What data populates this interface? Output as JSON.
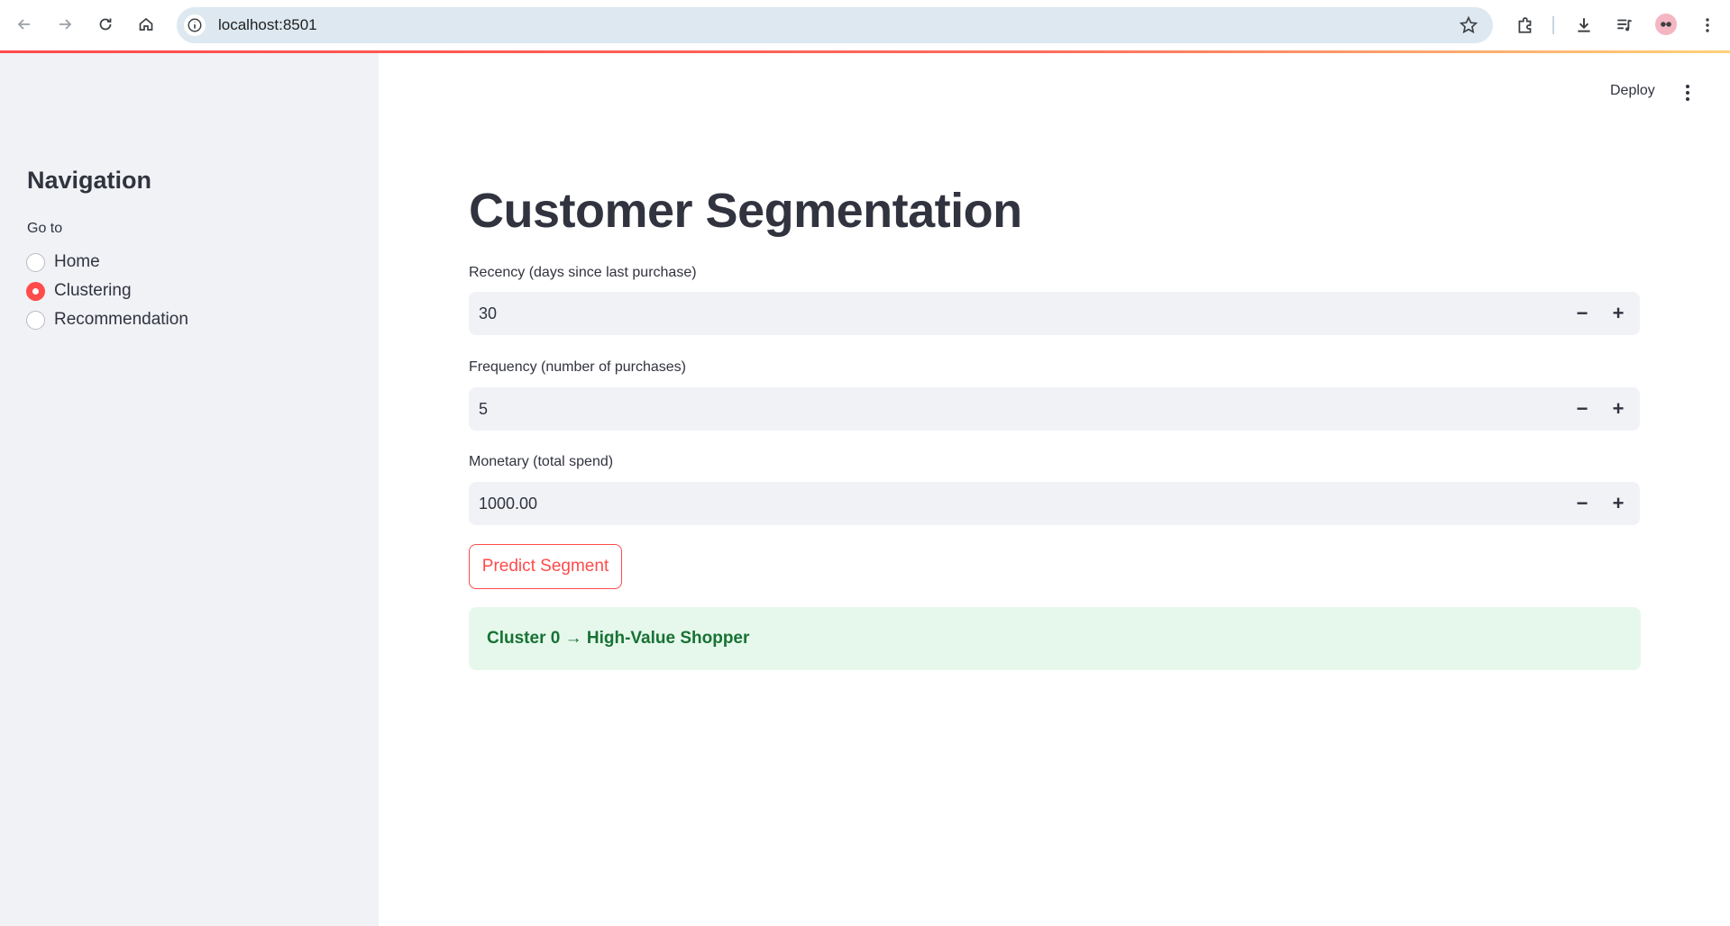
{
  "browser": {
    "url": "localhost:8501",
    "icons": [
      "back-arrow-icon",
      "forward-arrow-icon",
      "reload-icon",
      "home-icon",
      "site-info-icon",
      "bookmark-star-icon",
      "extensions-icon",
      "download-icon",
      "media-queue-icon",
      "profile-avatar-icon",
      "more-menu-icon"
    ]
  },
  "sidebar": {
    "heading": "Navigation",
    "group_label": "Go to",
    "options": [
      {
        "label": "Home",
        "selected": false
      },
      {
        "label": "Clustering",
        "selected": true
      },
      {
        "label": "Recommendation",
        "selected": false
      }
    ]
  },
  "header": {
    "deploy_label": "Deploy"
  },
  "main": {
    "title": "Customer Segmentation",
    "fields": [
      {
        "label": "Recency (days since last purchase)",
        "value": "30"
      },
      {
        "label": "Frequency (number of purchases)",
        "value": "5"
      },
      {
        "label": "Monetary (total spend)",
        "value": "1000.00"
      }
    ],
    "stepper_minus": "−",
    "stepper_plus": "+",
    "button_label": "Predict Segment",
    "result_text": "Cluster 0 → High-Value Shopper"
  },
  "colors": {
    "accent": "#ff4b4b",
    "sidebar_bg": "#f0f2f6",
    "success_bg": "#e6f8ec",
    "success_text": "#177233"
  }
}
